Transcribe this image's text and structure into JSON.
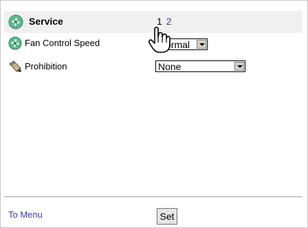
{
  "header": {
    "title": "Service",
    "icon": "fan-icon",
    "pages": [
      "1",
      "2"
    ]
  },
  "rows": [
    {
      "label": "Fan Control Speed",
      "icon": "fan-icon",
      "select_value": "ormal"
    },
    {
      "label": "Prohibition",
      "icon": "pen-icon",
      "select_value": "None"
    }
  ],
  "footer": {
    "menu_link": "To Menu",
    "set_label": "Set"
  },
  "colors": {
    "header_bg": "#f0f0f0",
    "link": "#3a3aa0",
    "fan_green": "#3aa06e"
  }
}
